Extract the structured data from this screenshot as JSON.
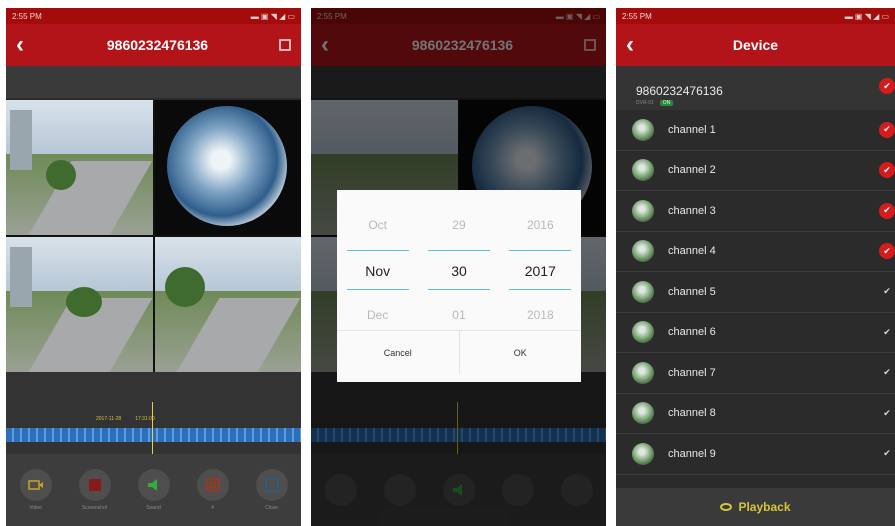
{
  "status": {
    "time": "2:55 PM"
  },
  "screen1": {
    "title": "9860232476136",
    "timeline_labels": [
      "2017-11-28",
      "17:31:00"
    ],
    "buttons": [
      {
        "icon": "video-icon",
        "label": "Video"
      },
      {
        "icon": "screenshot-icon",
        "label": "Screenshot"
      },
      {
        "icon": "sound-icon",
        "label": "Sound"
      },
      {
        "icon": "grid-icon",
        "label": "4"
      },
      {
        "icon": "close-icon",
        "label": "Close"
      }
    ]
  },
  "screen2": {
    "title": "9860232476136",
    "picker": {
      "months": [
        "Oct",
        "Nov",
        "Dec"
      ],
      "days": [
        "29",
        "30",
        "01"
      ],
      "years": [
        "2016",
        "2017",
        "2018"
      ]
    },
    "cancel": "Cancel",
    "ok": "OK"
  },
  "screen3": {
    "title": "Device",
    "device": {
      "id": "9860232476136",
      "sub": "DVR-01",
      "state": "ON"
    },
    "channels": [
      {
        "name": "channel 1",
        "checked": true
      },
      {
        "name": "channel 2",
        "checked": true
      },
      {
        "name": "channel 3",
        "checked": true
      },
      {
        "name": "channel 4",
        "checked": true
      },
      {
        "name": "channel 5",
        "checked": false
      },
      {
        "name": "channel 6",
        "checked": false
      },
      {
        "name": "channel 7",
        "checked": false
      },
      {
        "name": "channel 8",
        "checked": false
      },
      {
        "name": "channel 9",
        "checked": false
      }
    ],
    "playback": "Playback"
  },
  "colors": {
    "accent": "#b3141a",
    "timeline": "#2a6fb8",
    "highlight": "#d6c43a",
    "check_on": "#d41c1c"
  }
}
